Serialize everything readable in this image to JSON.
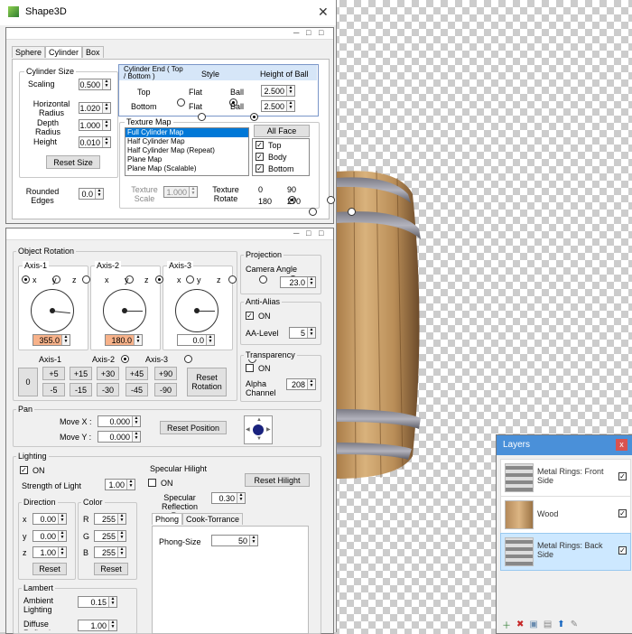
{
  "window": {
    "title": "Shape3D",
    "close": "✕"
  },
  "shape_panel": {
    "tabs": [
      "Sphere",
      "Cylinder",
      "Box"
    ],
    "cylinder_size": {
      "title": "Cylinder Size",
      "scaling_label": "Scaling",
      "scaling": "0.500",
      "hradius_label": "Horizontal Radius",
      "hradius": "1.020",
      "depth_label": "Depth Radius",
      "depth": "1.000",
      "height_label": "Height",
      "height": "0.010",
      "reset": "Reset Size"
    },
    "rounded_label": "Rounded Edges",
    "rounded": "0.0",
    "cyl_end": {
      "title": "Cylinder End ( Top / Bottom )",
      "style": "Style",
      "hob": "Height of Ball",
      "top_label": "Top",
      "top_val": "2.500",
      "bottom_label": "Bottom",
      "bottom_val": "2.500",
      "flat": "Flat",
      "ball": "Ball"
    },
    "texture": {
      "title": "Texture Map",
      "items": [
        "Full Cylinder Map",
        "Half Cylinder Map",
        "Half Cylinder Map (Repeat)",
        "Plane Map",
        "Plane Map (Scalable)"
      ],
      "all_face": "All Face",
      "faces": [
        "Top",
        "Body",
        "Bottom"
      ],
      "scale_label": "Texture Scale",
      "scale": "1.000",
      "rotate_label": "Texture Rotate",
      "rot": [
        "0",
        "90",
        "180",
        "270"
      ]
    }
  },
  "object_rotation": {
    "title": "Object Rotation",
    "axes": [
      "Axis-1",
      "Axis-2",
      "Axis-3"
    ],
    "xyz": [
      "x",
      "y",
      "z"
    ],
    "values": [
      "355.0",
      "180.0",
      "0.0"
    ],
    "axis_sel": [
      "Axis-1",
      "Axis-2",
      "Axis-3"
    ],
    "zero": "0",
    "steps_plus": [
      "+5",
      "+15",
      "+30",
      "+45",
      "+90"
    ],
    "steps_minus": [
      "-5",
      "-15",
      "-30",
      "-45",
      "-90"
    ],
    "reset": "Reset Rotation"
  },
  "projection": {
    "title": "Projection",
    "camera_label": "Camera Angle",
    "camera": "23.0"
  },
  "antialias": {
    "title": "Anti-Alias",
    "on": "ON",
    "level_label": "AA-Level",
    "level": "5"
  },
  "transparency": {
    "title": "Transparency",
    "on": "ON",
    "alpha_label": "Alpha Channel",
    "alpha": "208"
  },
  "pan": {
    "title": "Pan",
    "movex_label": "Move X :",
    "movex": "0.000",
    "movey_label": "Move Y :",
    "movey": "0.000",
    "reset": "Reset Position"
  },
  "lighting": {
    "title": "Lighting",
    "on": "ON",
    "strength_label": "Strength of Light",
    "strength": "1.00",
    "direction": {
      "title": "Direction",
      "x": "0.00",
      "y": "0.00",
      "z": "1.00",
      "reset": "Reset"
    },
    "color": {
      "title": "Color",
      "r": "255",
      "g": "255",
      "b": "255",
      "reset": "Reset"
    }
  },
  "specular": {
    "title": "Specular Hilight",
    "on": "ON",
    "reset": "Reset Hilight",
    "rate_label": "Specular Reflection Rate",
    "rate": "0.30",
    "tabs": [
      "Phong",
      "Cook-Torrance"
    ],
    "phong_label": "Phong-Size",
    "phong": "50"
  },
  "lambert": {
    "title": "Lambert",
    "ambient_label": "Ambient Lighting",
    "ambient": "0.15",
    "diffuse_label": "Diffuse Reflection Rate",
    "diffuse": "1.00"
  },
  "layers": {
    "title": "Layers",
    "close": "x",
    "items": [
      {
        "name": "Metal Rings: Front Side"
      },
      {
        "name": "Wood"
      },
      {
        "name": "Metal Rings: Back Side"
      }
    ]
  }
}
